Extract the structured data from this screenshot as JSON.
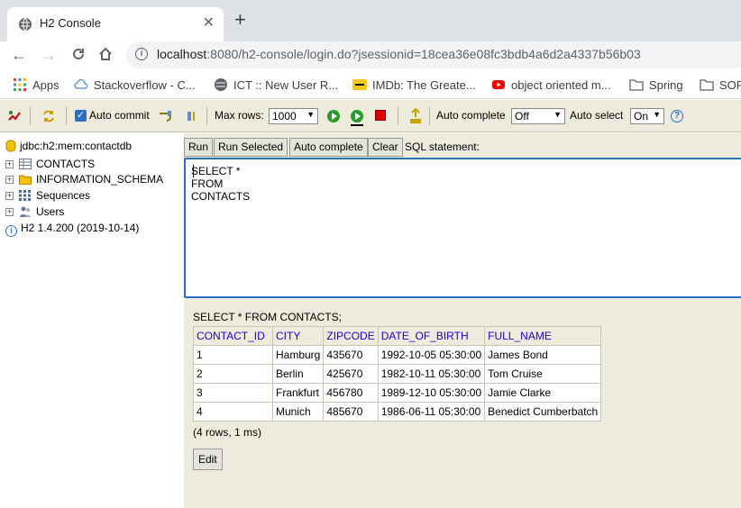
{
  "browser": {
    "tab_title": "H2 Console",
    "url_host": "localhost",
    "url_rest": ":8080/h2-console/login.do?jsessionid=18cea36e08fc3bdb4a6d2a4337b56b03",
    "bookmarks": [
      "Apps",
      "Stackoverflow - C...",
      "ICT :: New User R...",
      "IMDb: The Greate...",
      "object oriented m...",
      "Spring",
      "SOF"
    ]
  },
  "toolbar": {
    "auto_commit_label": "Auto commit",
    "max_rows_label": "Max rows:",
    "max_rows_value": "1000",
    "auto_complete_label": "Auto complete",
    "auto_complete_value": "Off",
    "auto_select_label": "Auto select",
    "auto_select_value": "On",
    "help_glyph": "?"
  },
  "tree": {
    "connection": "jdbc:h2:mem:contactdb",
    "items": [
      "CONTACTS",
      "INFORMATION_SCHEMA",
      "Sequences",
      "Users"
    ],
    "version": "H2 1.4.200 (2019-10-14)"
  },
  "sql": {
    "buttons": [
      "Run",
      "Run Selected",
      "Auto complete",
      "Clear"
    ],
    "label": "SQL statement:",
    "text": "SELECT * FROM CONTACTS"
  },
  "result": {
    "query": "SELECT * FROM CONTACTS;",
    "columns": [
      "CONTACT_ID",
      "CITY",
      "ZIPCODE",
      "DATE_OF_BIRTH",
      "FULL_NAME"
    ],
    "rows": [
      [
        "1",
        "Hamburg",
        "435670",
        "1992-10-05 05:30:00",
        "James Bond"
      ],
      [
        "2",
        "Berlin",
        "425670",
        "1982-10-11 05:30:00",
        "Tom Cruise"
      ],
      [
        "3",
        "Frankfurt",
        "456780",
        "1989-12-10 05:30:00",
        "Jamie Clarke"
      ],
      [
        "4",
        "Munich",
        "485670",
        "1986-06-11 05:30:00",
        "Benedict Cumberbatch"
      ]
    ],
    "row_info": "(4 rows, 1 ms)",
    "edit_label": "Edit"
  }
}
